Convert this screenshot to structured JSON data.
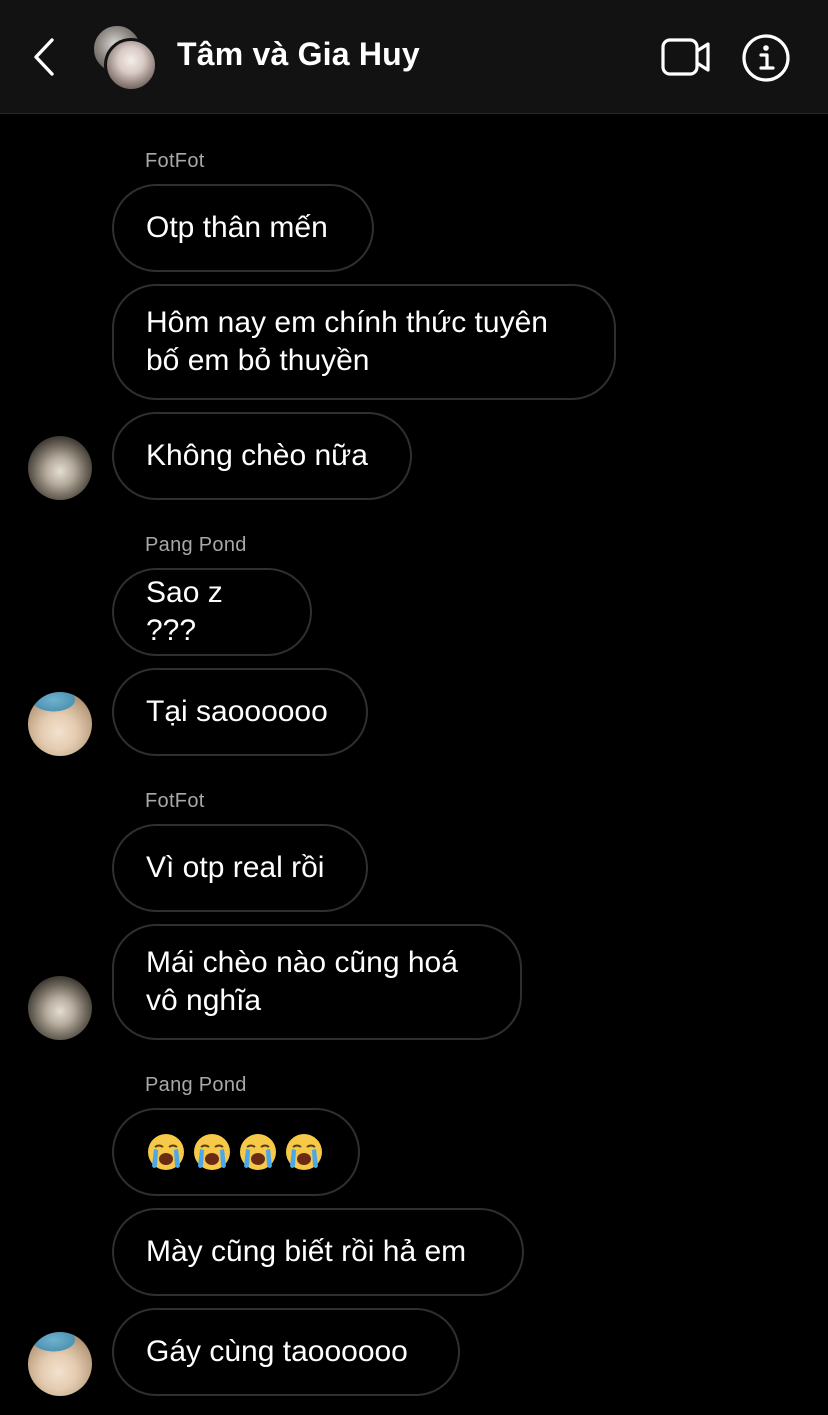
{
  "header": {
    "title": "Tâm và Gia Huy",
    "back_icon": "chevron-left-icon",
    "video_icon": "video-camera-icon",
    "info_icon": "info-icon"
  },
  "messages": [
    {
      "sender": "FotFot"
    },
    {
      "text": "Otp thân mến"
    },
    {
      "text_line1": "Hôm nay em chính thức tuyên",
      "text_line2": "bố em bỏ thuyền"
    },
    {
      "text": "Không chèo nữa"
    },
    {
      "sender": "Pang Pond"
    },
    {
      "text": "Sao z ???"
    },
    {
      "text": "Tại saoooooo"
    },
    {
      "sender": "FotFot"
    },
    {
      "text": "Vì otp real rồi"
    },
    {
      "text_line1": "Mái chèo nào cũng hoá",
      "text_line2": "vô nghĩa"
    },
    {
      "sender": "Pang Pond"
    },
    {
      "emoji": "loudly-crying-face",
      "count": 4
    },
    {
      "text": "Mày cũng biết rồi hả em"
    },
    {
      "text": "Gáy cùng taoooooo"
    }
  ],
  "colors": {
    "background": "#000000",
    "header_bg": "#121212",
    "bubble_border": "#2f2f2f",
    "sender_text": "#a8a8a8"
  }
}
